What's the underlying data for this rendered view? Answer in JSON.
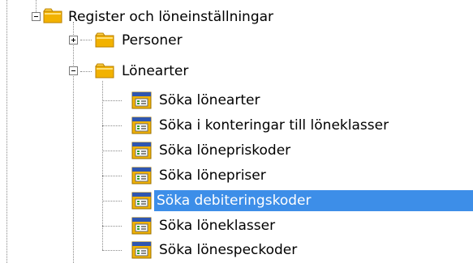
{
  "tree": {
    "root": {
      "label": "Register och löneinställningar",
      "expanded": true,
      "icon": "folder-icon"
    },
    "folders": [
      {
        "label": "Personer",
        "expanded": false,
        "icon": "folder-icon"
      },
      {
        "label": "Lönearter",
        "expanded": true,
        "icon": "folder-icon"
      }
    ],
    "items": [
      {
        "label": "Söka lönearter",
        "icon": "form-icon",
        "selected": false
      },
      {
        "label": "Söka i konteringar till löneklasser",
        "icon": "form-icon",
        "selected": false
      },
      {
        "label": "Söka lönepriskoder",
        "icon": "form-icon",
        "selected": false
      },
      {
        "label": "Söka lönepriser",
        "icon": "form-icon",
        "selected": false
      },
      {
        "label": "Söka debiteringskoder",
        "icon": "form-icon",
        "selected": true
      },
      {
        "label": "Söka löneklasser",
        "icon": "form-icon",
        "selected": false
      },
      {
        "label": "Söka lönespeckoder",
        "icon": "form-icon",
        "selected": false
      }
    ]
  },
  "colors": {
    "selection": "#3d8ee8",
    "selection_text": "#ffffff",
    "tree_lines": "#8a8a8a",
    "folder": "#f2b200"
  }
}
